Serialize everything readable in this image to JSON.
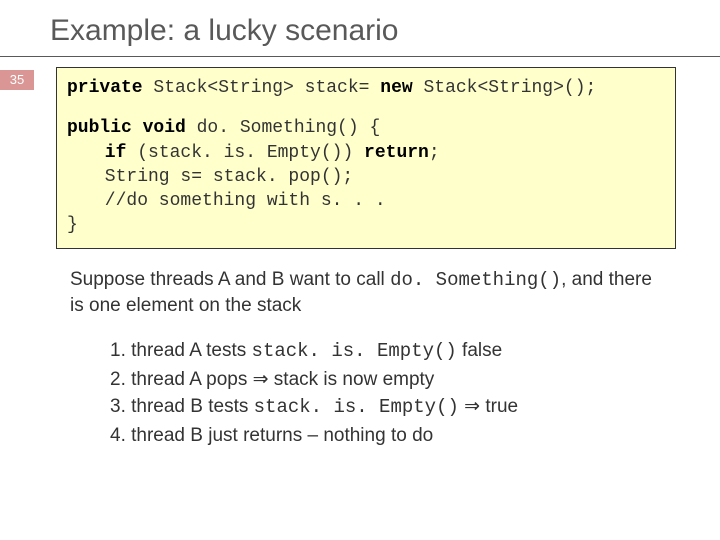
{
  "slide": {
    "title": "Example: a lucky scenario",
    "number": "35"
  },
  "code": {
    "l1_a": "private",
    "l1_b": " Stack<String> stack= ",
    "l1_c": "new",
    "l1_d": " Stack<String>();",
    "l2_a": "public void",
    "l2_b": " do. Something() {",
    "l3_a": "if",
    "l3_b": " (stack. is. Empty()) ",
    "l3_c": "return",
    "l3_d": ";",
    "l4": "String s= stack. pop();",
    "l5": "//do something with s. . .",
    "l6": "}"
  },
  "para": {
    "p_a": "Suppose threads A and B want to call ",
    "p_b": "do. Something()",
    "p_c": ", and there is one element on the stack"
  },
  "steps": {
    "s1_a": "1. thread A tests ",
    "s1_b": "stack. is. Empty()",
    "s1_c": " false",
    "s2": "2. thread A pops  ⇒  stack is now empty",
    "s3_a": "3. thread B tests ",
    "s3_b": "stack. is. Empty()",
    "s3_c": " ⇒ true",
    "s4": "4. thread B just returns – nothing to do"
  }
}
